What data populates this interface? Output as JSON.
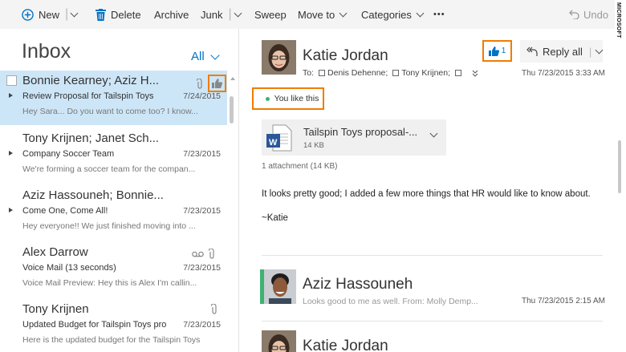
{
  "toolbar": {
    "new_label": "New",
    "delete_label": "Delete",
    "archive_label": "Archive",
    "junk_label": "Junk",
    "sweep_label": "Sweep",
    "move_to_label": "Move to",
    "categories_label": "Categories",
    "more_label": "•••",
    "undo_label": "Undo",
    "separator": "|"
  },
  "watermark": "MICROSOFT",
  "inbox": {
    "title": "Inbox",
    "filter_label": "All",
    "messages": [
      {
        "from": "Bonnie Kearney; Aziz H...",
        "subject": "Review Proposal for Tailspin Toys",
        "date": "7/24/2015",
        "preview": "Hey Sara... Do you want to come too? I know...",
        "selected": true
      },
      {
        "from": "Tony Krijnen; Janet Sch...",
        "subject": "Company Soccer Team",
        "date": "7/23/2015",
        "preview": "We're forming a soccer team for the compan..."
      },
      {
        "from": "Aziz Hassouneh; Bonnie...",
        "subject": "Come One, Come All!",
        "date": "7/23/2015",
        "preview": "Hey everyone!! We just finished moving into ..."
      },
      {
        "from": "Alex Darrow",
        "subject": "Voice Mail (13 seconds)",
        "date": "7/23/2015",
        "preview": "Voice Mail Preview:  Hey this is Alex I'm callin..."
      },
      {
        "from": "Tony Krijnen",
        "subject": "Updated Budget for Tailspin Toys pro",
        "date": "7/23/2015",
        "preview": "Here is the updated budget for the Tailspin Toys"
      }
    ]
  },
  "reading": {
    "sender": "Katie Jordan",
    "to_label": "To:",
    "recipients": [
      "Denis Dehenne;",
      "Tony Krijnen;"
    ],
    "date": "Thu 7/23/2015 3:33 AM",
    "like_count": "1",
    "reply_all_label": "Reply all",
    "you_like_label": "You like this",
    "attachment": {
      "name": "Tailspin Toys proposal-...",
      "size": "14 KB",
      "type_letter": "W"
    },
    "attachment_count": "1 attachment (14 KB)",
    "body": "It looks pretty good; I added a few more things that HR would like to know about.",
    "signature": "~Katie",
    "thread": [
      {
        "sender": "Aziz Hassouneh",
        "preview": "Looks good to me as well. From: Molly Demp...",
        "date": "Thu 7/23/2015 2:15 AM"
      },
      {
        "sender": "Katie Jordan"
      }
    ]
  },
  "colors": {
    "accent": "#0072c6",
    "highlight": "#f07c00",
    "selected_bg": "#cde6f7",
    "presence": "#3cb371",
    "word": "#2b579a"
  }
}
